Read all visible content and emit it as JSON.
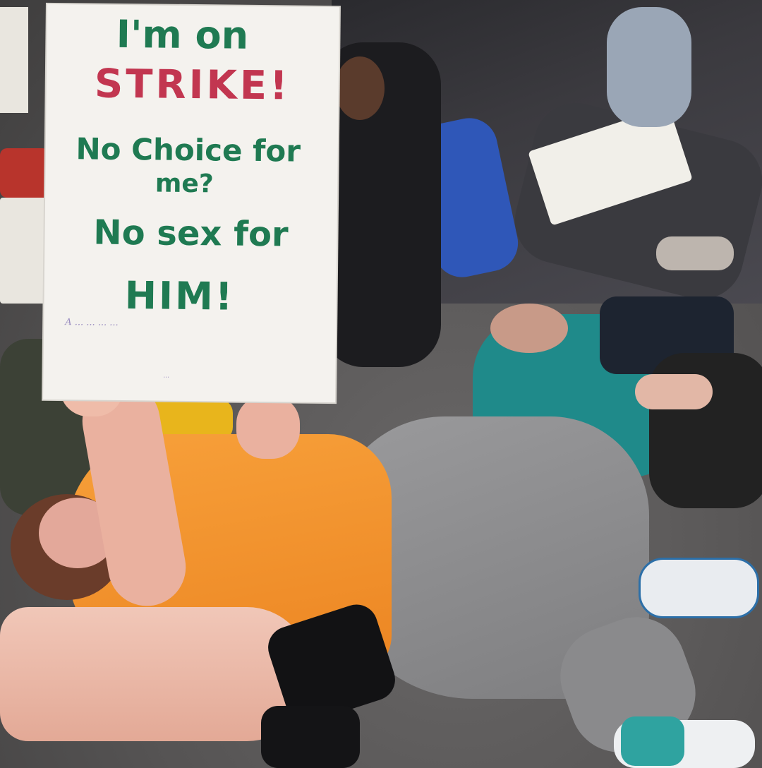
{
  "sign": {
    "line1": "I'm on",
    "line2": "STRIKE!",
    "line3": "No Choice for",
    "line4": "me?",
    "line5": "No sex for",
    "line6": "HIM!",
    "quote_text": "A  ...  ...  ...  ...",
    "attribution": "..."
  },
  "colors": {
    "sign_green": "#1f7a52",
    "sign_red": "#c23650",
    "sign_paper": "#f4f2ee",
    "shirt_orange": "#f2902e",
    "leggings_gray": "#8e8e90",
    "jacket_teal": "#1f8a8a",
    "asphalt": "#5b5a5a"
  }
}
